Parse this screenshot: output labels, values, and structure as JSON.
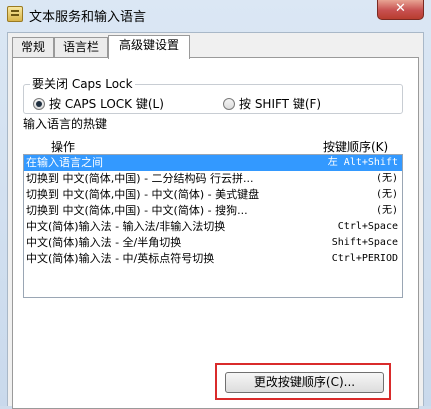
{
  "window": {
    "title": "文本服务和输入语言",
    "close_label": "✕"
  },
  "tabs": [
    {
      "label": "常规"
    },
    {
      "label": "语言栏"
    },
    {
      "label": "高级键设置"
    }
  ],
  "caps_lock": {
    "title": "要关闭 Caps Lock",
    "option1": "按 CAPS LOCK 键(L)",
    "option2": "按 SHIFT 键(F)",
    "selected": "option1"
  },
  "hotkeys": {
    "title": "输入语言的热键",
    "col_action": "操作",
    "col_key": "按键顺序(K)",
    "rows": [
      {
        "action": "在输入语言之间",
        "key": "左 Alt+Shift",
        "selected": true
      },
      {
        "action": "切换到 中文(简体,中国) - 二分结构码 行云拼...",
        "key": "(无)"
      },
      {
        "action": "切换到 中文(简体,中国) - 中文(简体) - 美式键盘",
        "key": "(无)"
      },
      {
        "action": "切换到 中文(简体,中国) - 中文(简体) - 搜狗...",
        "key": "(无)"
      },
      {
        "action": "中文(简体)输入法 - 输入法/非输入法切换",
        "key": "Ctrl+Space"
      },
      {
        "action": "中文(简体)输入法 - 全/半角切换",
        "key": "Shift+Space"
      },
      {
        "action": "中文(简体)输入法 - 中/英标点符号切换",
        "key": "Ctrl+PERIOD"
      }
    ]
  },
  "change_button": {
    "label": "更改按键顺序(C)..."
  },
  "colors": {
    "highlight": "#d92b2b",
    "selection": "#3399ff"
  }
}
